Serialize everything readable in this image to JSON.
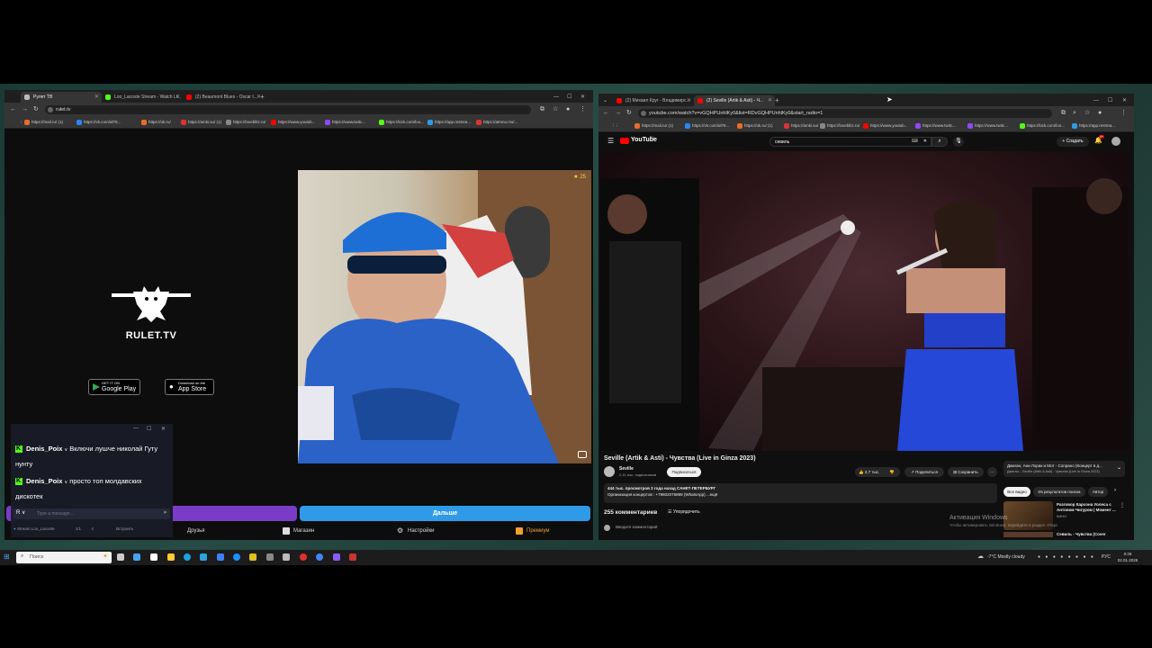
{
  "left_window": {
    "tabs": [
      {
        "label": "Рулет ТВ",
        "active": true
      },
      {
        "label": "Loo_Lacoste Stream - Watch Li...",
        "active": false
      },
      {
        "label": "(2) Beaumont Blues - Oscar I...",
        "active": false
      }
    ],
    "url": "rulet.tv",
    "bookmarks": [
      "https://mail.ru/ (1)",
      "https://vk.com/id78...",
      "https://ok.ru/",
      "https://amki.su/ (1)",
      "https://loveblitz.ru/",
      "https://www.youtub...",
      "https://www.twitc...",
      "https://kick.com/loo...",
      "https://app.restrea...",
      "https://atmno.ms/..."
    ]
  },
  "rulet": {
    "logo_text": "RULET.TV",
    "google_play_top": "GET IT ON",
    "google_play": "Google Play",
    "app_store_top": "Download on the",
    "app_store": "App Store",
    "webcam_badge": "25",
    "next_button": "Дальше",
    "nav": {
      "friends": "Друзья",
      "shop": "Магазин",
      "settings": "Настройки",
      "premium": "Премиум"
    }
  },
  "chat": {
    "messages": [
      {
        "user": "Denis_Poix",
        "text": "Включи лушче николай Гуту нунту"
      },
      {
        "user": "Denis_Poix",
        "text": "просто топ молдавских дискотек"
      }
    ],
    "input_placeholder": "Type a message...",
    "footer_channel": "Stream Loo_Lacoste",
    "footer_viewers": "1/1",
    "footer_count": "4",
    "footer_label": "Встроить"
  },
  "right_window": {
    "tabs": [
      {
        "label": "(2) Михаил Круг - Владимирс...",
        "active": false
      },
      {
        "label": "(2) Seville (Artik & Asti) - Ч...",
        "active": true
      }
    ],
    "url": "youtube.com/watch?v=vGQHPUnhlKy0&list=RDvGQHPUnhlKy0&start_radio=1",
    "bookmarks": [
      "https://mail.ru/ (1)",
      "https://vk.com/id78...",
      "https://ok.ru/ (1)",
      "https://amki.su/",
      "https://loveblitz.ru/",
      "https://www.youtub...",
      "https://www.twitc...",
      "https://www.twitc...",
      "https://kick.com/loo...",
      "https://app.restrea..."
    ]
  },
  "youtube": {
    "logo": "YouTube",
    "region": "RU",
    "search_value": "севиль",
    "create_label": "Создать",
    "notif_count": "9+",
    "title": "Seville (Artik & Asti) - Чувства (Live in Ginza 2023)",
    "channel": "Seville",
    "subscribers": "2,11 тыс. подписчиков",
    "subscribe": "Подписаться",
    "likes": "2,7 тыс.",
    "share": "Поделиться",
    "save": "Сохранить",
    "desc_line1": "444 тыс. просмотров  2 года назад  САНКТ-ПЕТЕРБУРГ",
    "desc_line2": "Организация концертов : +79602076899 (WhatsApp) ...ещё",
    "comments_count": "255 комментариев",
    "sort": "Упорядочить",
    "comment_placeholder": "Введите комментарий",
    "mix_title": "Джиган, Ани Лорак и Мот - Сопрано (Концерт в д...",
    "mix_sub": "Джиган – Seville (Artik & Asti) - Чувства (Live in Ginza 2023)",
    "chips": [
      "Все видео",
      "Из результатов поиска",
      "Автор"
    ],
    "rec1_title": "Разговор Карсона Уолеса с Антоном Чигуром | Момент ...",
    "rec1_channel": "КИНО",
    "rec2_title": "Севиль - Чувства (Cover"
  },
  "windows_activation": {
    "line1": "Активация Windows",
    "line2": "Чтобы активировать Windows, перейдите в раздел «Параметры»."
  },
  "taskbar": {
    "search_placeholder": "Поиск",
    "weather": "-7°C   Mostly cloudy",
    "lang": "РУС",
    "time": "0:26",
    "date": "02.01.2026"
  },
  "colors": {
    "kick_green": "#53fc18",
    "youtube_red": "#ff0000",
    "purple": "#7a3cc7",
    "blue": "#2f9be8"
  }
}
